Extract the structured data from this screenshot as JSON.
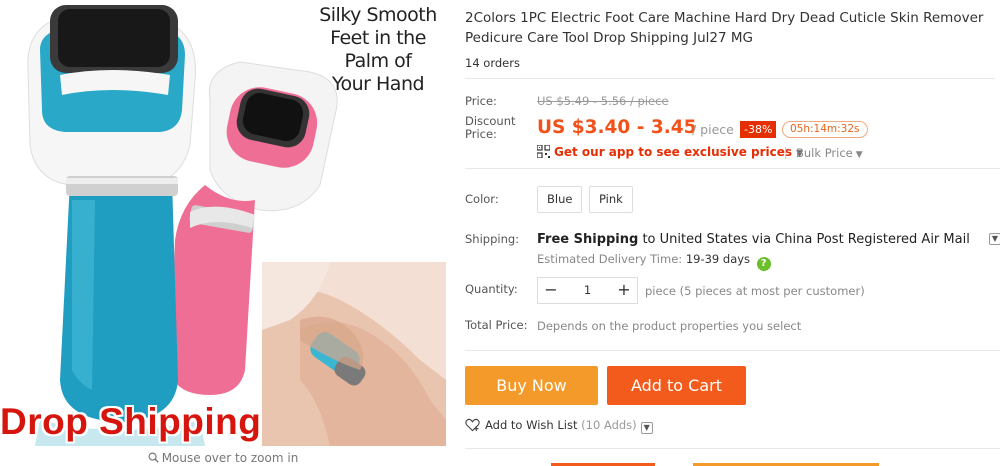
{
  "gallery": {
    "slogan": "Silky Smooth\nFeet in the\nPalm of\nYour Hand",
    "overlay_text": "Drop Shipping",
    "zoom_hint": "Mouse over to zoom in",
    "roller_colors": {
      "blue": "#2aa8c8",
      "pink": "#ef6e95"
    }
  },
  "product": {
    "title": "2Colors 1PC Electric Foot Care Machine Hard Dry Dead Cuticle Skin Remover Pedicure Care Tool Drop Shipping Jul27 MG",
    "orders": "14 orders"
  },
  "price": {
    "price_label": "Price:",
    "original": "US $5.49 - 5.56 / piece",
    "discount_label": "Discount\nPrice:",
    "discounted": "US $3.40 - 3.45",
    "unit": "/ piece",
    "off_badge": "-38%",
    "countdown": "05h:14m:32s",
    "app_promo": "Get our app to see exclusive prices",
    "bulk_price": "Bulk Price"
  },
  "options": {
    "color_label": "Color:",
    "colors": [
      "Blue",
      "Pink"
    ],
    "shipping_label": "Shipping:",
    "shipping_free": "Free Shipping",
    "shipping_rest": " to United States via China Post Registered Air Mail",
    "eta_label": "Estimated Delivery Time:",
    "eta_value": "19-39 days",
    "quantity_label": "Quantity:",
    "quantity_minus": "−",
    "quantity_value": "1",
    "quantity_plus": "+",
    "quantity_note": "piece (5 pieces at most per customer)",
    "total_label": "Total Price:",
    "total_note": "Depends on the product properties you select"
  },
  "actions": {
    "buy_now": "Buy Now",
    "add_to_cart": "Add to Cart",
    "wish_list": "Add to Wish List",
    "wish_count": "(10 Adds)"
  },
  "colors": {
    "accent_orange": "#f35b1c",
    "buy_orange": "#f39a2b",
    "price_red": "#f2511a",
    "badge_red": "#e62e04",
    "help_green": "#6cbf2a"
  }
}
